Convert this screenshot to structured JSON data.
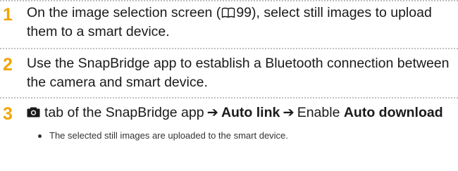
{
  "steps": [
    {
      "number": "1",
      "text_before_ref": "On the image selection screen (",
      "page_ref": "99",
      "text_after_ref": "), select still images to upload them to a smart device."
    },
    {
      "number": "2",
      "text": "Use the SnapBridge app to establish a Bluetooth connection between the camera and smart device."
    },
    {
      "number": "3",
      "icon": "camera-icon",
      "tab_text": "tab of the SnapBridge app",
      "arrow": "➔",
      "menu_item": "Auto link",
      "arrow2": "➔",
      "enable_text": "Enable",
      "option": "Auto download",
      "note": "The selected still images are uploaded to the smart device."
    }
  ],
  "colors": {
    "step_number": "#f0a500",
    "divider": "#c0c0c0",
    "text": "#1a1a1a"
  },
  "icons": {
    "page_reference": "book-icon",
    "camera": "camera-icon",
    "arrow": "arrow-right-icon"
  }
}
